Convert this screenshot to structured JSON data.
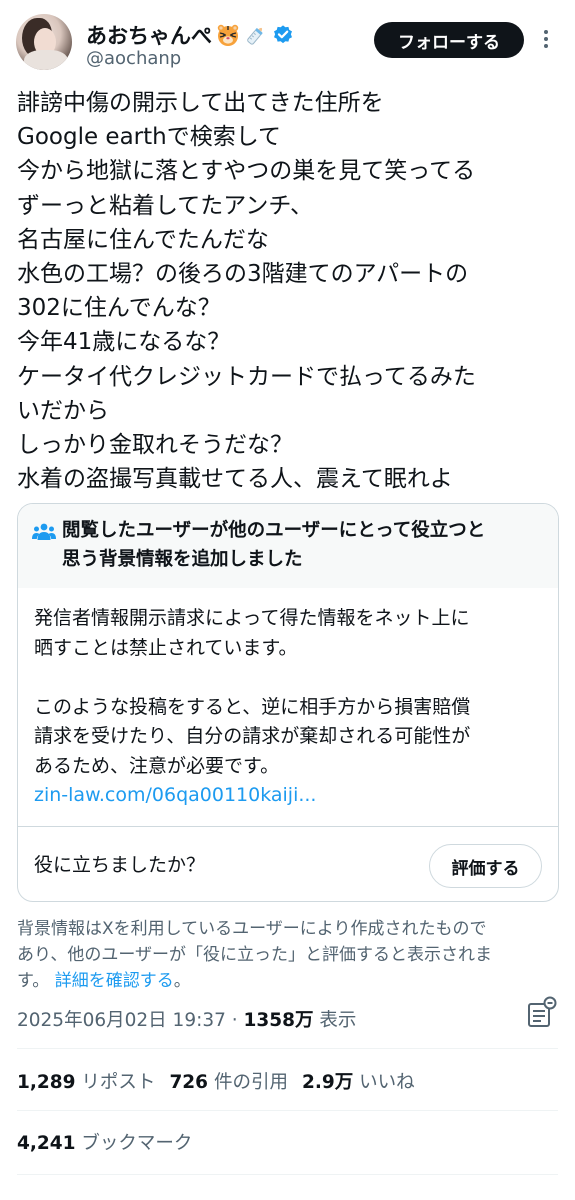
{
  "user": {
    "display_name": "あおちゃんぺ",
    "handle": "@aochanp",
    "follow_label": "フォローする",
    "emoji": [
      "tiger-face-emoji",
      "baby-bottle-emoji"
    ],
    "verified_color": "#1d9bf0"
  },
  "tweet": {
    "lines": [
      "誹謗中傷の開示して出てきた住所を",
      "Google earthで検索して",
      "今から地獄に落とすやつの巣を見て笑ってる",
      "ずーっと粘着してたアンチ、",
      "名古屋に住んでたんだな",
      "水色の工場？の後ろの3階建てのアパートの",
      "302に住んでんな？",
      "今年41歳になるな？",
      "ケータイ代クレジットカードで払ってるみた",
      "いだから",
      "しっかり金取れそうだな？",
      "水着の盗撮写真載せてる人、震えて眠れよ"
    ]
  },
  "community_note": {
    "title_line1": "閲覧したユーザーが他のユーザーにとって役立つと",
    "title_line2": "思う背景情報を追加しました",
    "body_para1_line1": "発信者情報開示請求によって得た情報をネット上に",
    "body_para1_line2": "晒すことは禁止されています。",
    "body_para2_line1": "このような投稿をすると、逆に相手方から損害賠償",
    "body_para2_line2": "請求を受けたり、自分の請求が棄却される可能性が",
    "body_para2_line3": "あるため、注意が必要です。",
    "link_text": "zin-law.com/06qa00110kaiji...",
    "question": "役に立ちましたか？",
    "rate_label": "評価する"
  },
  "note_footer": {
    "line1": "背景情報はXを利用しているユーザーにより作成されたもので",
    "line2": "あり、他のユーザーが「役に立った」と評価すると表示されま",
    "line3_prefix": "す。",
    "line3_link": "詳細を確認する",
    "line3_suffix": "。"
  },
  "meta": {
    "timestamp": "2025年06月02日 19:37",
    "separator": "·",
    "views_count": "1358万",
    "views_label": "表示"
  },
  "stats": {
    "reposts_count": "1,289",
    "reposts_label": "リポスト",
    "quotes_count": "726",
    "quotes_label": "件の引用",
    "likes_count": "2.9万",
    "likes_label": "いいね",
    "bookmarks_count": "4,241",
    "bookmarks_label": "ブックマーク"
  },
  "colors": {
    "text": "#0f1419",
    "secondary": "#536471",
    "link": "#1d9bf0",
    "border": "#cfd9de",
    "note_header_bg": "#f7f9f9",
    "follow_bg": "#0f1419"
  }
}
